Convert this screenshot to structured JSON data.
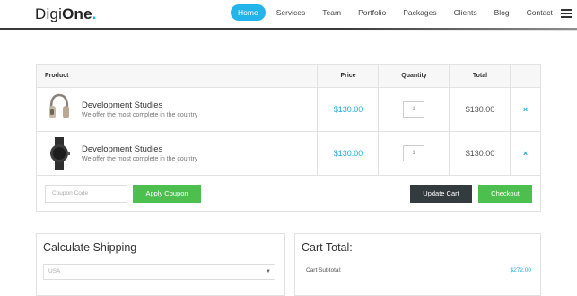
{
  "brand": {
    "name_light": "Digi",
    "name_bold": "One",
    "dot": "."
  },
  "nav": [
    {
      "label": "Home",
      "active": true
    },
    {
      "label": "Services",
      "active": false
    },
    {
      "label": "Team",
      "active": false
    },
    {
      "label": "Portfolio",
      "active": false
    },
    {
      "label": "Packages",
      "active": false
    },
    {
      "label": "Clients",
      "active": false
    },
    {
      "label": "Blog",
      "active": false
    },
    {
      "label": "Contact",
      "active": false
    }
  ],
  "cart": {
    "headers": {
      "product": "Product",
      "price": "Price",
      "quantity": "Quantity",
      "total": "Total"
    },
    "items": [
      {
        "name": "Development Studies",
        "description": "We offer the most complete in the country",
        "price": "$130.00",
        "quantity": "1",
        "total": "$130.00",
        "remove": "×",
        "image_icon": "headphones-icon"
      },
      {
        "name": "Development Studies",
        "description": "We offer the most complete in the country",
        "price": "$130.00",
        "quantity": "1",
        "total": "$130.00",
        "remove": "×",
        "image_icon": "smartwatch-icon"
      }
    ],
    "coupon_placeholder": "Coupon Code",
    "apply_coupon_label": "Apply Coupon",
    "update_cart_label": "Update Cart",
    "checkout_label": "Checkout"
  },
  "shipping": {
    "title": "Calculate Shipping",
    "country_selected": "USA"
  },
  "cart_total": {
    "title": "Cart Total:",
    "subtotal_label": "Cart Subtotal:",
    "subtotal_value": "$272.00"
  },
  "colors": {
    "accent": "#24b4ec",
    "green": "#4cbf4f",
    "dark_button": "#333b3e",
    "price_text": "#1fb0d8"
  }
}
